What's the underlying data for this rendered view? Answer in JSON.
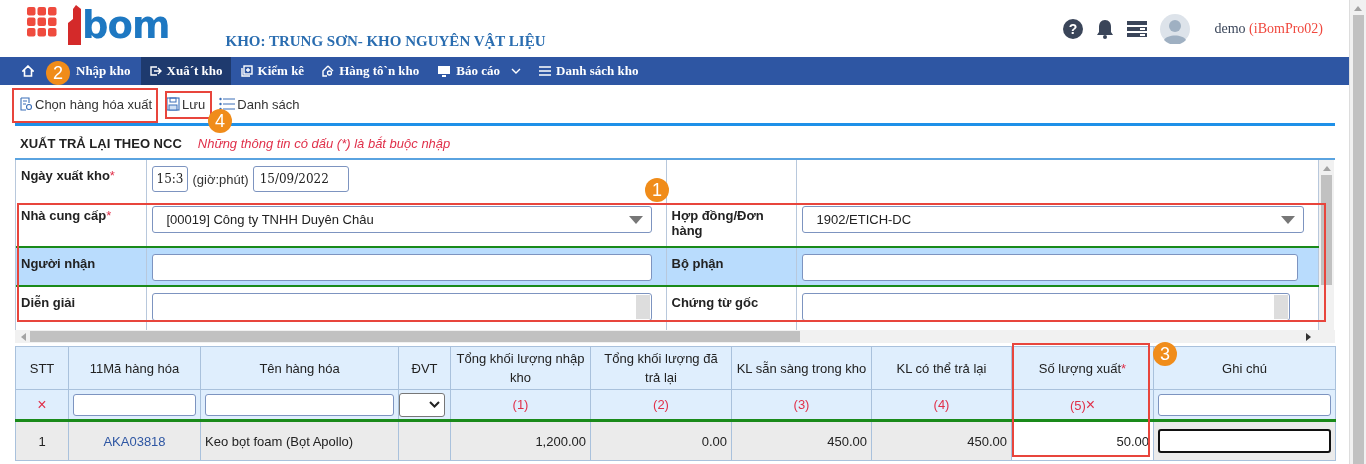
{
  "header": {
    "logo_text": "bom",
    "warehouse_title": "KHO: TRUNG SƠN- KHO NGUYÊN VẬT LIỆU",
    "user_name": "demo",
    "account": "(iBomPro02)"
  },
  "help_glyph": "?",
  "nav": [
    {
      "label": "Nhập kho",
      "selected": false
    },
    {
      "label": "Xuâ´t kho",
      "selected": true
    },
    {
      "label": "Kiểm kê",
      "selected": false
    },
    {
      "label": "Hàng tô`n kho",
      "selected": false
    },
    {
      "label": "Báo cáo",
      "selected": false,
      "dropdown": true
    },
    {
      "label": "Danh sách kho",
      "selected": false
    }
  ],
  "toolbar": [
    {
      "label": "Chọn hàng hóa xuất"
    },
    {
      "label": "Lưu"
    },
    {
      "label": "Danh sách"
    }
  ],
  "form": {
    "title": "XUẤT TRẢ LẠI THEO NCC",
    "note": "Những thông tin có dấu (*) là bắt buộc nhập",
    "rows": [
      {
        "highlighted": false,
        "cells": [
          {
            "label": "Ngày xuất kho",
            "required_mark": "*",
            "field": {
              "kind": "datetime",
              "time": "15:3",
              "hint": "(giờ:phút)",
              "date": "15/09/2022"
            }
          }
        ]
      },
      {
        "highlighted": false,
        "cells": [
          {
            "label": "Nhà cung cấp",
            "required_mark": "*",
            "field": {
              "kind": "select",
              "value": "[00019] Công ty TNHH Duyên Châu"
            }
          },
          {
            "label": "Hợp đồng/Đơn hàng",
            "field": {
              "kind": "select",
              "value": "1902/ETICH-DC"
            }
          }
        ]
      },
      {
        "highlighted": true,
        "cells": [
          {
            "label": "Người nhận",
            "field": {
              "kind": "input"
            }
          },
          {
            "label": "Bộ phận",
            "field": {
              "kind": "input"
            }
          }
        ]
      },
      {
        "highlighted": false,
        "cells": [
          {
            "label": "Diễn giải",
            "field": {
              "kind": "textarea"
            }
          },
          {
            "label": "Chứng từ gốc",
            "field": {
              "kind": "textarea"
            }
          }
        ]
      }
    ]
  },
  "table": {
    "columns": [
      {
        "header": "STT",
        "filter": {
          "kind": "delete",
          "text": "×"
        }
      },
      {
        "header": "11Mã hàng hóa",
        "filter": {
          "kind": "input"
        }
      },
      {
        "header": "Tên hàng hóa",
        "filter": {
          "kind": "input"
        }
      },
      {
        "header": "ĐVT",
        "filter": {
          "kind": "select"
        }
      },
      {
        "header": "Tổng khối lượng nhập kho",
        "filter": {
          "kind": "index",
          "text": "(1)"
        }
      },
      {
        "header": "Tổng khối lượng đã trả lại",
        "filter": {
          "kind": "index",
          "text": "(2)"
        }
      },
      {
        "header": "KL sẵn sàng trong kho",
        "filter": {
          "kind": "index",
          "text": "(3)"
        }
      },
      {
        "header": "KL có thể trả lại",
        "filter": {
          "kind": "index",
          "text": "(4)"
        }
      },
      {
        "header": "Số lượng xuất",
        "required_mark": "*",
        "filter": {
          "kind": "index",
          "text": "(5)",
          "delete": "×"
        }
      },
      {
        "header": "Ghi chú",
        "filter": {
          "kind": "input"
        }
      }
    ],
    "rows": [
      {
        "cells": [
          {
            "kind": "text",
            "text": "1"
          },
          {
            "kind": "link",
            "text": "AKA03818"
          },
          {
            "kind": "text",
            "text": "Keo bọt foam (Bọt Apollo)"
          },
          {
            "kind": "empty"
          },
          {
            "kind": "number",
            "text": "1,200.00"
          },
          {
            "kind": "number",
            "text": "0.00"
          },
          {
            "kind": "number",
            "text": "450.00"
          },
          {
            "kind": "number",
            "text": "450.00"
          },
          {
            "kind": "editable",
            "text": "50.00"
          },
          {
            "kind": "input",
            "focused": true
          }
        ]
      }
    ]
  },
  "annotations": [
    {
      "number": "1"
    },
    {
      "number": "2"
    },
    {
      "number": "3"
    },
    {
      "number": "4"
    }
  ]
}
